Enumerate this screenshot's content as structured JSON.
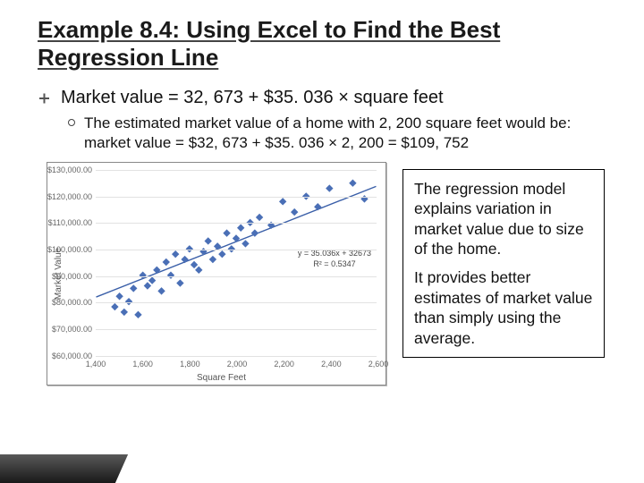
{
  "title": "Example 8.4: Using Excel to Find the Best Regression Line",
  "bullet_main": "Market value = 32, 673 + $35. 036 × square feet",
  "bullet_sub": "The estimated market value of a home with 2, 200 square feet would be: market value = $32, 673 + $35. 036 × 2, 200 = $109, 752",
  "sidebox_p1": "The regression model explains variation in market value  due to size of the home.",
  "sidebox_p2": "It provides better estimates of market value than simply using the average.",
  "chart_data": {
    "type": "scatter",
    "xlabel": "Square Feet",
    "ylabel": "Market Value",
    "xlim": [
      1400,
      2600
    ],
    "ylim": [
      60000,
      130000
    ],
    "xticks": [
      1400,
      1600,
      1800,
      2000,
      2200,
      2400,
      2600
    ],
    "yticks": [
      "$60,000.00",
      "$70,000.00",
      "$80,000.00",
      "$90,000.00",
      "$100,000.00",
      "$110,000.00",
      "$120,000.00",
      "$130,000.00"
    ],
    "equation_line1": "y = 35.036x + 32673",
    "equation_line2": "R² = 0.5347",
    "regression": {
      "slope": 35.036,
      "intercept": 32673
    },
    "points": [
      [
        1480,
        78000
      ],
      [
        1500,
        82000
      ],
      [
        1520,
        76000
      ],
      [
        1540,
        80000
      ],
      [
        1560,
        85000
      ],
      [
        1580,
        75000
      ],
      [
        1600,
        90000
      ],
      [
        1620,
        86000
      ],
      [
        1640,
        88000
      ],
      [
        1660,
        92000
      ],
      [
        1680,
        84000
      ],
      [
        1700,
        95000
      ],
      [
        1720,
        90000
      ],
      [
        1740,
        98000
      ],
      [
        1760,
        87000
      ],
      [
        1780,
        96000
      ],
      [
        1800,
        100000
      ],
      [
        1820,
        94000
      ],
      [
        1840,
        92000
      ],
      [
        1860,
        99000
      ],
      [
        1880,
        103000
      ],
      [
        1900,
        96000
      ],
      [
        1920,
        101000
      ],
      [
        1940,
        98000
      ],
      [
        1960,
        106000
      ],
      [
        1980,
        100000
      ],
      [
        2000,
        104000
      ],
      [
        2020,
        108000
      ],
      [
        2040,
        102000
      ],
      [
        2060,
        110000
      ],
      [
        2080,
        106000
      ],
      [
        2100,
        112000
      ],
      [
        2150,
        109000
      ],
      [
        2200,
        118000
      ],
      [
        2250,
        114000
      ],
      [
        2300,
        120000
      ],
      [
        2350,
        116000
      ],
      [
        2400,
        123000
      ],
      [
        2500,
        125000
      ],
      [
        2550,
        119000
      ]
    ]
  }
}
